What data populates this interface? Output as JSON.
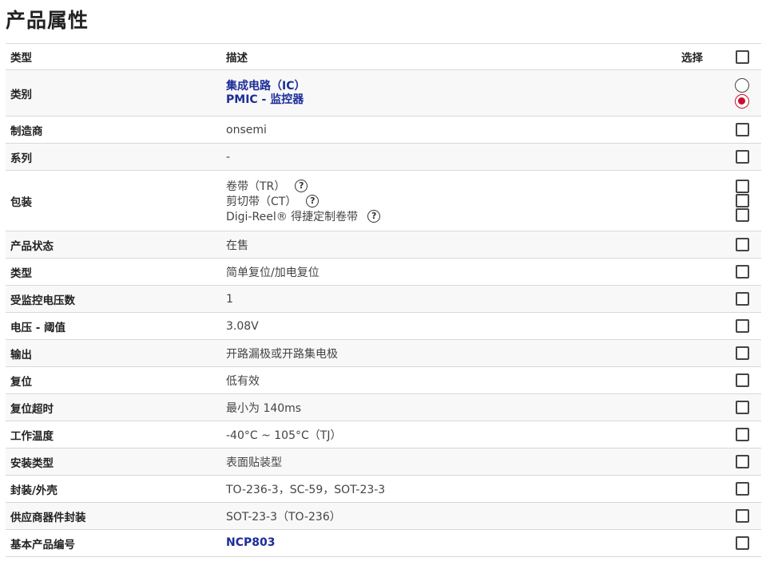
{
  "title": "产品属性",
  "headers": {
    "type": "类型",
    "desc": "描述",
    "select": "选择"
  },
  "category": {
    "label": "类别",
    "line1": "集成电路（IC）",
    "line2": "PMIC - 监控器"
  },
  "manufacturer": {
    "label": "制造商",
    "value": "onsemi"
  },
  "series": {
    "label": "系列",
    "value": "-"
  },
  "packaging": {
    "label": "包装",
    "options": [
      "卷带（TR）",
      "剪切带（CT）",
      "Digi-Reel® 得捷定制卷带"
    ]
  },
  "rows": [
    {
      "label": "产品状态",
      "value": "在售"
    },
    {
      "label": "类型",
      "value": "简单复位/加电复位"
    },
    {
      "label": "受监控电压数",
      "value": "1"
    },
    {
      "label": "电压 - 阈值",
      "value": "3.08V"
    },
    {
      "label": "输出",
      "value": "开路漏极或开路集电极"
    },
    {
      "label": "复位",
      "value": "低有效"
    },
    {
      "label": "复位超时",
      "value": "最小为 140ms"
    },
    {
      "label": "工作温度",
      "value": "-40°C ~ 105°C（TJ）"
    },
    {
      "label": "安装类型",
      "value": "表面贴装型"
    },
    {
      "label": "封装/外壳",
      "value": "TO-236-3，SC-59，SOT-23-3"
    },
    {
      "label": "供应商器件封装",
      "value": "SOT-23-3（TO-236）"
    }
  ],
  "base_part": {
    "label": "基本产品编号",
    "value": "NCP803"
  },
  "colors": {
    "link": "#1c2d98",
    "radio_selected": "#c8102e"
  }
}
